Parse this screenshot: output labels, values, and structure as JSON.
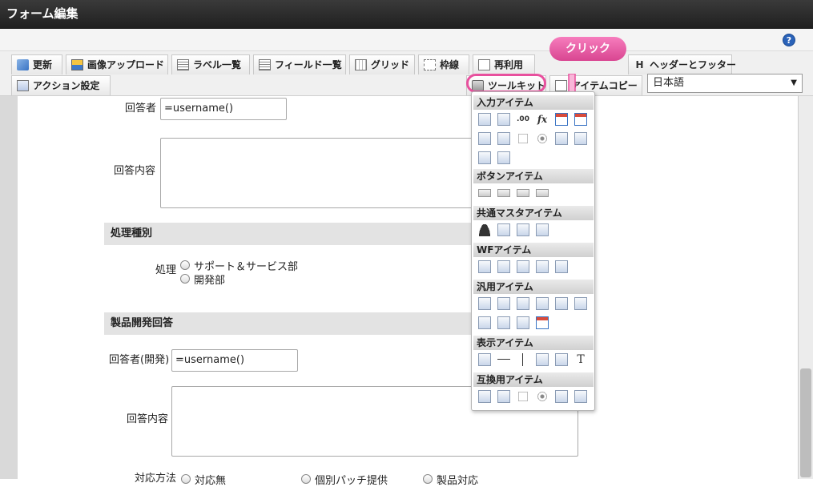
{
  "window": {
    "title": "フォーム編集"
  },
  "help": {
    "icon": "help-icon",
    "label": "?"
  },
  "toolbar": {
    "row1": [
      {
        "label": "更新",
        "icon": "refresh-icon"
      },
      {
        "label": "画像アップロード",
        "icon": "image-upload-icon"
      },
      {
        "label": "ラベル一覧",
        "icon": "label-list-icon"
      },
      {
        "label": "フィールド一覧",
        "icon": "field-list-icon"
      },
      {
        "label": "グリッド",
        "icon": "grid-icon"
      },
      {
        "label": "枠線",
        "icon": "border-icon"
      },
      {
        "label": "再利用",
        "icon": "reuse-icon"
      },
      {
        "label": "ヘッダーとフッター",
        "icon": "header-footer-icon"
      }
    ],
    "row2": [
      {
        "label": "アクション設定",
        "icon": "action-icon"
      },
      {
        "label": "ツールキット",
        "icon": "toolkit-icon"
      },
      {
        "label": "アイテムコピー",
        "icon": "item-copy-icon"
      }
    ],
    "language": {
      "value": "日本語"
    }
  },
  "callout": {
    "label": "クリック"
  },
  "form": {
    "respondent_label": "回答者",
    "respondent_value": "=username()",
    "answer_label": "回答内容",
    "section1_title": "処理種別",
    "process_label": "処理",
    "process_options": [
      "サポート＆サービス部",
      "開発部"
    ],
    "section2_title": "製品開発回答",
    "dev_respondent_label": "回答者(開発)",
    "dev_respondent_value": "=username()",
    "dev_answer_label": "回答内容",
    "method_label": "対応方法",
    "method_options": [
      "対応無",
      "個別パッチ提供",
      "製品対応"
    ]
  },
  "toolkit": {
    "groups": [
      {
        "title": "入力アイテム"
      },
      {
        "title": "ボタンアイテム"
      },
      {
        "title": "共通マスタアイテム"
      },
      {
        "title": "WFアイテム"
      },
      {
        "title": "汎用アイテム"
      },
      {
        "title": "表示アイテム"
      },
      {
        "title": "互換用アイテム"
      }
    ],
    "fx_label": "fx",
    "num_label": ".00",
    "text_label": "T",
    "colors": {
      "blue": "#3a74c4",
      "pink": "#e8509e",
      "gray": "#d0d0d0"
    }
  }
}
